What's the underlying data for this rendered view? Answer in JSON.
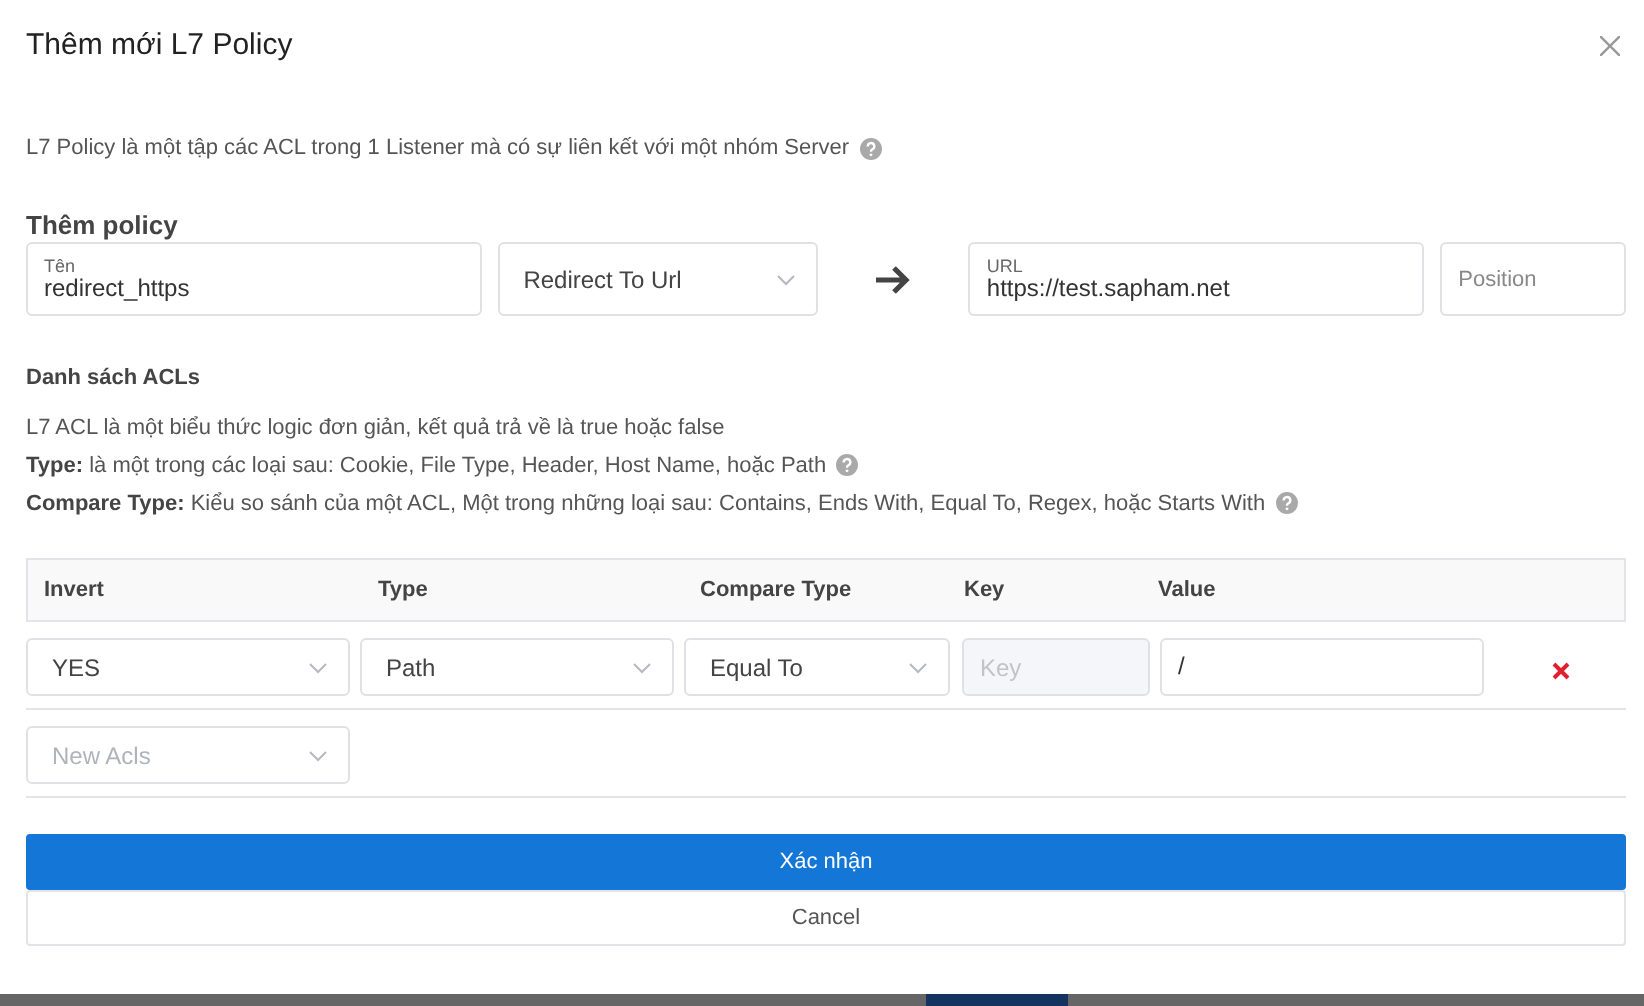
{
  "dialog": {
    "title": "Thêm mới L7 Policy",
    "description": "L7 Policy là một tập các ACL trong 1 Listener mà có sự liên kết với một nhóm Server"
  },
  "policy": {
    "heading": "Thêm policy",
    "name_field": {
      "label": "Tên",
      "value": "redirect_https"
    },
    "action_select": {
      "value": "Redirect To Url"
    },
    "url_field": {
      "label": "URL",
      "value": "https://test.sapham.net"
    },
    "position_field": {
      "placeholder": "Position"
    }
  },
  "acls": {
    "heading": "Danh sách ACLs",
    "lines": [
      {
        "text": "L7 ACL là một biểu thức logic đơn giản, kết quả trả về là true hoặc false",
        "help": false
      },
      {
        "text": "**Type:** là một trong các loại sau: Cookie, File Type, Header, Host Name, hoặc Path",
        "help": true
      },
      {
        "text": "**Compare Type:** Kiểu so sánh của một ACL, Một trong những loại sau: Contains, Ends With, Equal To, Regex, hoặc Starts With",
        "help": true
      }
    ]
  },
  "table": {
    "columns": [
      "Invert",
      "Type",
      "Compare Type",
      "Key",
      "Value"
    ],
    "rows": [
      {
        "invert": "YES",
        "type": "Path",
        "compare_type": "Equal To",
        "key": {
          "placeholder": "Key",
          "disabled": true
        },
        "value": "/"
      }
    ]
  },
  "new_acl_select": {
    "placeholder": "New Acls"
  },
  "buttons": [
    {
      "label": "Xác nhận",
      "kind": "primary"
    },
    {
      "label": "Cancel",
      "kind": "secondary"
    }
  ]
}
